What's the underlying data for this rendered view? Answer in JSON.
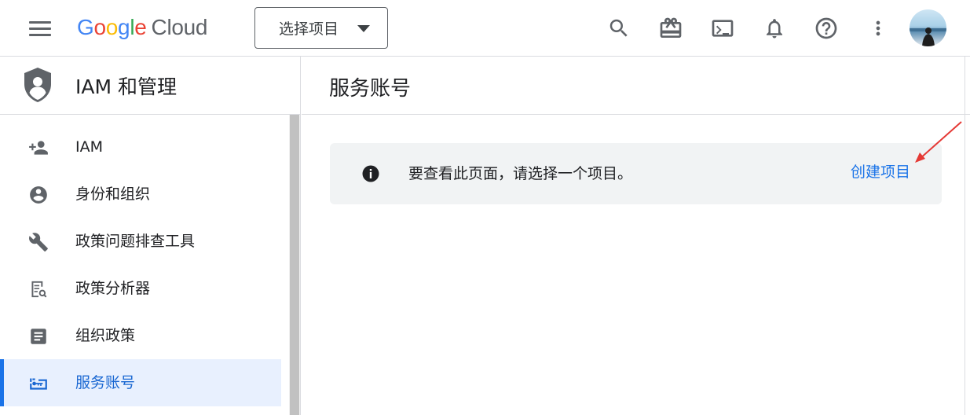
{
  "topbar": {
    "logo": {
      "google": [
        "G",
        "o",
        "o",
        "g",
        "l",
        "e"
      ],
      "cloud": "Cloud"
    },
    "project_picker_label": "选择项目",
    "icons": [
      "search-icon",
      "gift-icon",
      "terminal-icon",
      "bell-icon",
      "help-icon",
      "more-vert-icon"
    ]
  },
  "sidebar": {
    "title": "IAM 和管理",
    "items": [
      {
        "label": "IAM",
        "icon": "person-add-icon"
      },
      {
        "label": "身份和组织",
        "icon": "account-circle-icon"
      },
      {
        "label": "政策问题排查工具",
        "icon": "wrench-icon"
      },
      {
        "label": "政策分析器",
        "icon": "policy-analyzer-icon"
      },
      {
        "label": "组织政策",
        "icon": "article-icon"
      },
      {
        "label": "服务账号",
        "icon": "service-account-icon",
        "active": true
      }
    ]
  },
  "main": {
    "title": "服务账号",
    "notice": {
      "message": "要查看此页面，请选择一个项目。",
      "link": "创建项目"
    }
  },
  "colors": {
    "link": "#1a73e8",
    "active_bg": "#e8f0fe",
    "notice_bg": "#f1f3f4",
    "annotation_arrow": "#e53935"
  }
}
